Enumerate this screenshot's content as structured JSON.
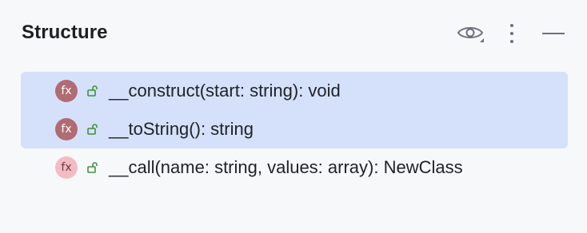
{
  "panel": {
    "title": "Structure",
    "actions": [
      {
        "icon": "eye-icon",
        "label": "Show options"
      },
      {
        "icon": "more-vertical-icon",
        "label": "Options"
      },
      {
        "icon": "minimize-icon",
        "label": "Hide"
      }
    ]
  },
  "structure": {
    "items": [
      {
        "label": "__construct(start: string): void",
        "icon": "function-icon",
        "visibility": "public",
        "selected": true
      },
      {
        "label": "__toString(): string",
        "icon": "function-icon",
        "visibility": "public",
        "selected": true
      },
      {
        "label": "__call(name: string, values: array): NewClass",
        "icon": "function-icon",
        "visibility": "public",
        "selected": false
      }
    ],
    "icon_text": "fx"
  },
  "colors": {
    "background": "#f7f8fa",
    "selection": "#d5e1fa",
    "function_icon_dark": "#b06b73",
    "function_icon_light": "#f3bcc2",
    "lock_green": "#3f8f3f"
  }
}
